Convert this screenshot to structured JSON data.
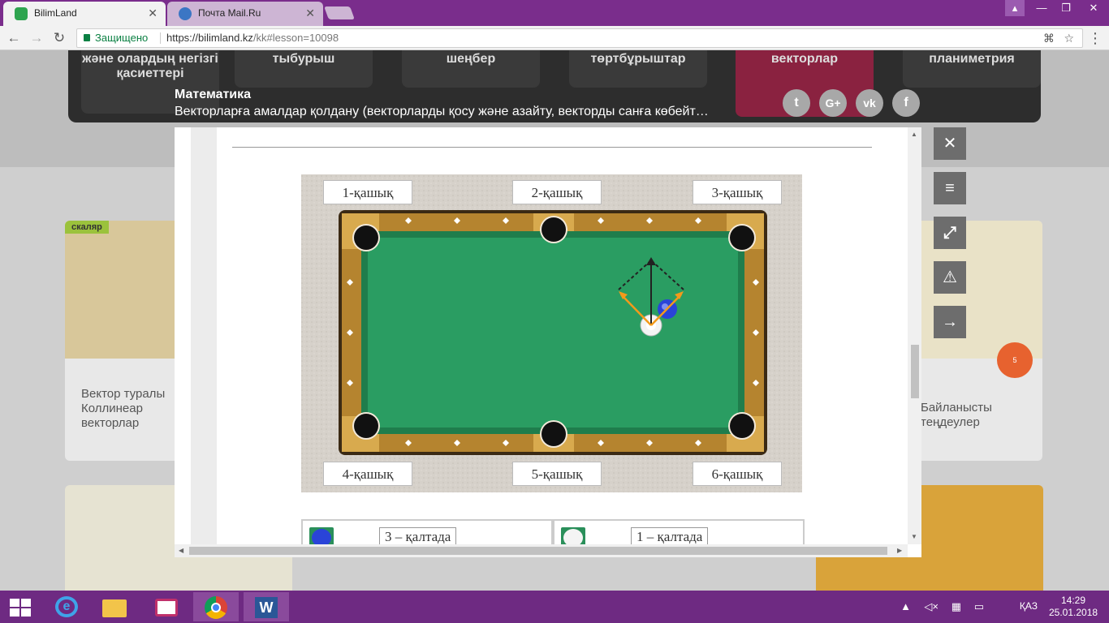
{
  "browser": {
    "tabs": [
      {
        "title": "BilimLand",
        "active": true,
        "color": "#2ea44f"
      },
      {
        "title": "Почта Mail.Ru",
        "active": false,
        "color": "#3b76c4"
      }
    ],
    "address": {
      "secure_label": "Защищено",
      "url_host": "https://bilimland.kz",
      "url_path": "/kk#lesson=10098"
    }
  },
  "background": {
    "topics": [
      "және олардың негізгі қасиеттері",
      "тыбурыш",
      "шеңбер",
      "төртбұрыштар",
      "векторлар",
      "планиметрия"
    ],
    "cards": [
      {
        "tag": "скаляр",
        "caption": "Вектор туралы Коллинеар векторлар"
      },
      {
        "caption": "Байланысты теңдеулер"
      }
    ]
  },
  "lesson": {
    "subject": "Математика",
    "title": "Векторларға амалдар қолдану (векторларды қосу және азайту, векторды санға көбейт…"
  },
  "social": [
    {
      "name": "twitter",
      "glyph": "t"
    },
    {
      "name": "google-plus",
      "glyph": "G+"
    },
    {
      "name": "vk",
      "glyph": "vk"
    },
    {
      "name": "facebook",
      "glyph": "f"
    }
  ],
  "scene": {
    "pockets": [
      "1-қашық",
      "2-қашық",
      "3-қашық",
      "4-қашық",
      "5-қашық",
      "6-қашық"
    ]
  },
  "answers": [
    {
      "ball": "blue",
      "text": "3 – қалтада"
    },
    {
      "ball": "white",
      "text": "1 – қалтада"
    }
  ],
  "tools": [
    "close",
    "menu",
    "fullscreen",
    "warning",
    "next"
  ],
  "taskbar": {
    "time": "14:29",
    "date": "25.01.2018",
    "lang": "ҚАЗ"
  },
  "colors": {
    "felt": "#2a9d62",
    "rail": "#b5842f",
    "tab_bar": "#7a2d8c",
    "taskbar": "#6e2a82"
  }
}
